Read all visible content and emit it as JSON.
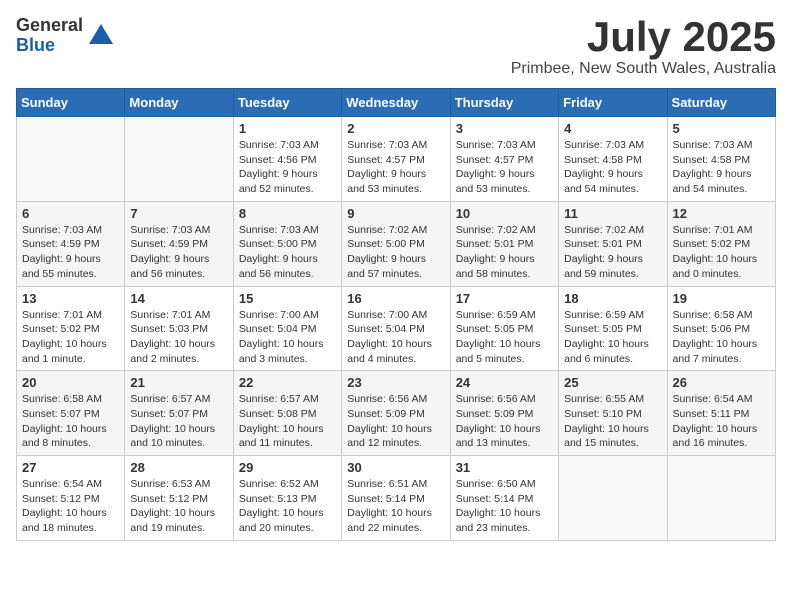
{
  "logo": {
    "general": "General",
    "blue": "Blue"
  },
  "title": {
    "month_year": "July 2025",
    "location": "Primbee, New South Wales, Australia"
  },
  "headers": [
    "Sunday",
    "Monday",
    "Tuesday",
    "Wednesday",
    "Thursday",
    "Friday",
    "Saturday"
  ],
  "weeks": [
    [
      {
        "day": "",
        "info": ""
      },
      {
        "day": "",
        "info": ""
      },
      {
        "day": "1",
        "info": "Sunrise: 7:03 AM\nSunset: 4:56 PM\nDaylight: 9 hours\nand 52 minutes."
      },
      {
        "day": "2",
        "info": "Sunrise: 7:03 AM\nSunset: 4:57 PM\nDaylight: 9 hours\nand 53 minutes."
      },
      {
        "day": "3",
        "info": "Sunrise: 7:03 AM\nSunset: 4:57 PM\nDaylight: 9 hours\nand 53 minutes."
      },
      {
        "day": "4",
        "info": "Sunrise: 7:03 AM\nSunset: 4:58 PM\nDaylight: 9 hours\nand 54 minutes."
      },
      {
        "day": "5",
        "info": "Sunrise: 7:03 AM\nSunset: 4:58 PM\nDaylight: 9 hours\nand 54 minutes."
      }
    ],
    [
      {
        "day": "6",
        "info": "Sunrise: 7:03 AM\nSunset: 4:59 PM\nDaylight: 9 hours\nand 55 minutes."
      },
      {
        "day": "7",
        "info": "Sunrise: 7:03 AM\nSunset: 4:59 PM\nDaylight: 9 hours\nand 56 minutes."
      },
      {
        "day": "8",
        "info": "Sunrise: 7:03 AM\nSunset: 5:00 PM\nDaylight: 9 hours\nand 56 minutes."
      },
      {
        "day": "9",
        "info": "Sunrise: 7:02 AM\nSunset: 5:00 PM\nDaylight: 9 hours\nand 57 minutes."
      },
      {
        "day": "10",
        "info": "Sunrise: 7:02 AM\nSunset: 5:01 PM\nDaylight: 9 hours\nand 58 minutes."
      },
      {
        "day": "11",
        "info": "Sunrise: 7:02 AM\nSunset: 5:01 PM\nDaylight: 9 hours\nand 59 minutes."
      },
      {
        "day": "12",
        "info": "Sunrise: 7:01 AM\nSunset: 5:02 PM\nDaylight: 10 hours\nand 0 minutes."
      }
    ],
    [
      {
        "day": "13",
        "info": "Sunrise: 7:01 AM\nSunset: 5:02 PM\nDaylight: 10 hours\nand 1 minute."
      },
      {
        "day": "14",
        "info": "Sunrise: 7:01 AM\nSunset: 5:03 PM\nDaylight: 10 hours\nand 2 minutes."
      },
      {
        "day": "15",
        "info": "Sunrise: 7:00 AM\nSunset: 5:04 PM\nDaylight: 10 hours\nand 3 minutes."
      },
      {
        "day": "16",
        "info": "Sunrise: 7:00 AM\nSunset: 5:04 PM\nDaylight: 10 hours\nand 4 minutes."
      },
      {
        "day": "17",
        "info": "Sunrise: 6:59 AM\nSunset: 5:05 PM\nDaylight: 10 hours\nand 5 minutes."
      },
      {
        "day": "18",
        "info": "Sunrise: 6:59 AM\nSunset: 5:05 PM\nDaylight: 10 hours\nand 6 minutes."
      },
      {
        "day": "19",
        "info": "Sunrise: 6:58 AM\nSunset: 5:06 PM\nDaylight: 10 hours\nand 7 minutes."
      }
    ],
    [
      {
        "day": "20",
        "info": "Sunrise: 6:58 AM\nSunset: 5:07 PM\nDaylight: 10 hours\nand 8 minutes."
      },
      {
        "day": "21",
        "info": "Sunrise: 6:57 AM\nSunset: 5:07 PM\nDaylight: 10 hours\nand 10 minutes."
      },
      {
        "day": "22",
        "info": "Sunrise: 6:57 AM\nSunset: 5:08 PM\nDaylight: 10 hours\nand 11 minutes."
      },
      {
        "day": "23",
        "info": "Sunrise: 6:56 AM\nSunset: 5:09 PM\nDaylight: 10 hours\nand 12 minutes."
      },
      {
        "day": "24",
        "info": "Sunrise: 6:56 AM\nSunset: 5:09 PM\nDaylight: 10 hours\nand 13 minutes."
      },
      {
        "day": "25",
        "info": "Sunrise: 6:55 AM\nSunset: 5:10 PM\nDaylight: 10 hours\nand 15 minutes."
      },
      {
        "day": "26",
        "info": "Sunrise: 6:54 AM\nSunset: 5:11 PM\nDaylight: 10 hours\nand 16 minutes."
      }
    ],
    [
      {
        "day": "27",
        "info": "Sunrise: 6:54 AM\nSunset: 5:12 PM\nDaylight: 10 hours\nand 18 minutes."
      },
      {
        "day": "28",
        "info": "Sunrise: 6:53 AM\nSunset: 5:12 PM\nDaylight: 10 hours\nand 19 minutes."
      },
      {
        "day": "29",
        "info": "Sunrise: 6:52 AM\nSunset: 5:13 PM\nDaylight: 10 hours\nand 20 minutes."
      },
      {
        "day": "30",
        "info": "Sunrise: 6:51 AM\nSunset: 5:14 PM\nDaylight: 10 hours\nand 22 minutes."
      },
      {
        "day": "31",
        "info": "Sunrise: 6:50 AM\nSunset: 5:14 PM\nDaylight: 10 hours\nand 23 minutes."
      },
      {
        "day": "",
        "info": ""
      },
      {
        "day": "",
        "info": ""
      }
    ]
  ]
}
